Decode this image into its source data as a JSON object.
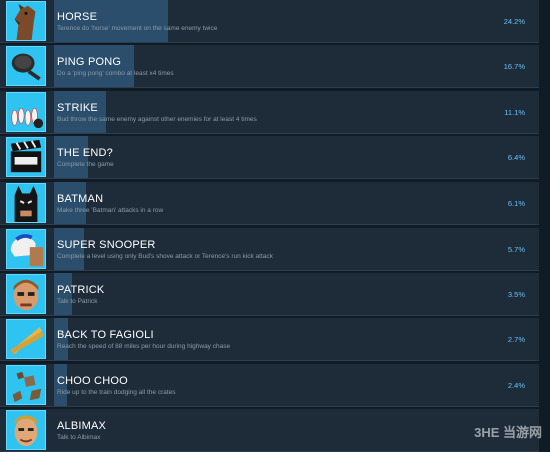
{
  "achievements": [
    {
      "icon": "horse-icon",
      "title": "HORSE",
      "description": "Terence do 'horse' movement on the same enemy twice",
      "percent": "24.2%",
      "percent_value": 24.2
    },
    {
      "icon": "frying-pan-icon",
      "title": "PING PONG",
      "description": "Do a 'ping pong' combo at least x4 times",
      "percent": "16.7%",
      "percent_value": 16.7
    },
    {
      "icon": "bowling-pins-icon",
      "title": "STRIKE",
      "description": "Bud throw the same enemy against other enemies for at least 4 times",
      "percent": "11.1%",
      "percent_value": 11.1
    },
    {
      "icon": "clapperboard-icon",
      "title": "THE END?",
      "description": "Complete the game",
      "percent": "6.4%",
      "percent_value": 6.4
    },
    {
      "icon": "batman-mask-icon",
      "title": "BATMAN",
      "description": "Make three 'Batman' attacks in a row",
      "percent": "6.1%",
      "percent_value": 6.1
    },
    {
      "icon": "football-helmet-icon",
      "title": "SUPER SNOOPER",
      "description": "Complete a level using only Bud's shove attack or Terence's run kick attack",
      "percent": "5.7%",
      "percent_value": 5.7
    },
    {
      "icon": "patrick-face-icon",
      "title": "PATRICK",
      "description": "Talk to Patrick",
      "percent": "3.5%",
      "percent_value": 3.5
    },
    {
      "icon": "sausage-sticks-icon",
      "title": "BACK TO FAGIOLI",
      "description": "Reach the speed of 88 miles per hour during highway chase",
      "percent": "2.7%",
      "percent_value": 2.7
    },
    {
      "icon": "crate-debris-icon",
      "title": "CHOO CHOO",
      "description": "Ride up to the train dodging all the crates",
      "percent": "2.4%",
      "percent_value": 2.4
    },
    {
      "icon": "albimax-face-icon",
      "title": "ALBIMAX",
      "description": "Talk to Albimax",
      "percent": "",
      "percent_value": null
    }
  ],
  "watermark": "3HE 当游网"
}
